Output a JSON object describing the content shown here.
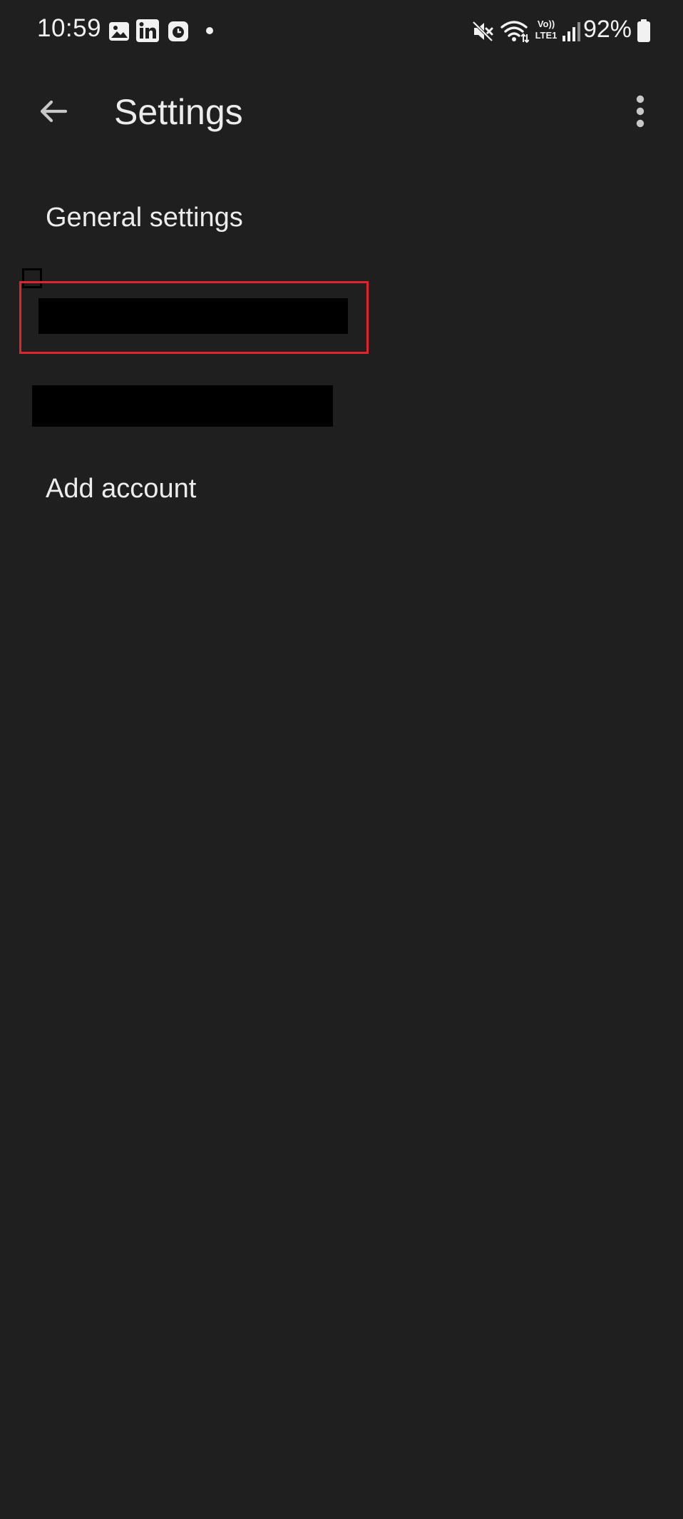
{
  "status_bar": {
    "time": "10:59",
    "battery": "92%",
    "icons": [
      "gallery-icon",
      "linkedin-icon",
      "clock-app-icon",
      "notification-dot-icon",
      "mute-icon",
      "wifi-icon",
      "volte-icon",
      "signal-icon",
      "battery-icon"
    ],
    "volte_label_top": "Vo))",
    "volte_label_bottom": "LTE1"
  },
  "app_bar": {
    "title": "Settings",
    "back_icon": "arrow-back-icon",
    "more_icon": "more-vert-icon"
  },
  "list": {
    "general_settings": "General settings",
    "add_account": "Add account"
  },
  "colors": {
    "background": "#1f1f1f",
    "text": "#ececec",
    "highlight": "#e0232e",
    "redaction": "#000000"
  }
}
